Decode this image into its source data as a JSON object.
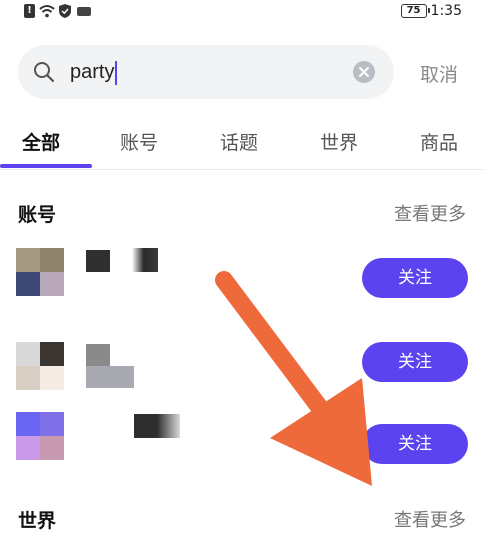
{
  "status_bar": {
    "time": "1:35",
    "battery": "75",
    "icons": [
      "alert-icon",
      "wifi-icon",
      "shield-icon",
      "tag-icon"
    ]
  },
  "search": {
    "value": "party",
    "cancel_label": "取消",
    "icons": [
      "search-icon",
      "clear-icon"
    ]
  },
  "tabs": [
    {
      "label": "全部",
      "active": true
    },
    {
      "label": "账号",
      "active": false
    },
    {
      "label": "话题",
      "active": false
    },
    {
      "label": "世界",
      "active": false
    },
    {
      "label": "商品",
      "active": false
    }
  ],
  "accounts_section": {
    "title": "账号",
    "see_more": "查看更多",
    "rows": [
      {
        "follow_label": "关注"
      },
      {
        "follow_label": "关注"
      },
      {
        "follow_label": "关注"
      }
    ]
  },
  "world_section": {
    "title": "世界",
    "see_more": "查看更多"
  },
  "colors": {
    "accent": "#5b43ef",
    "annotation_arrow": "#ef6a3a"
  }
}
